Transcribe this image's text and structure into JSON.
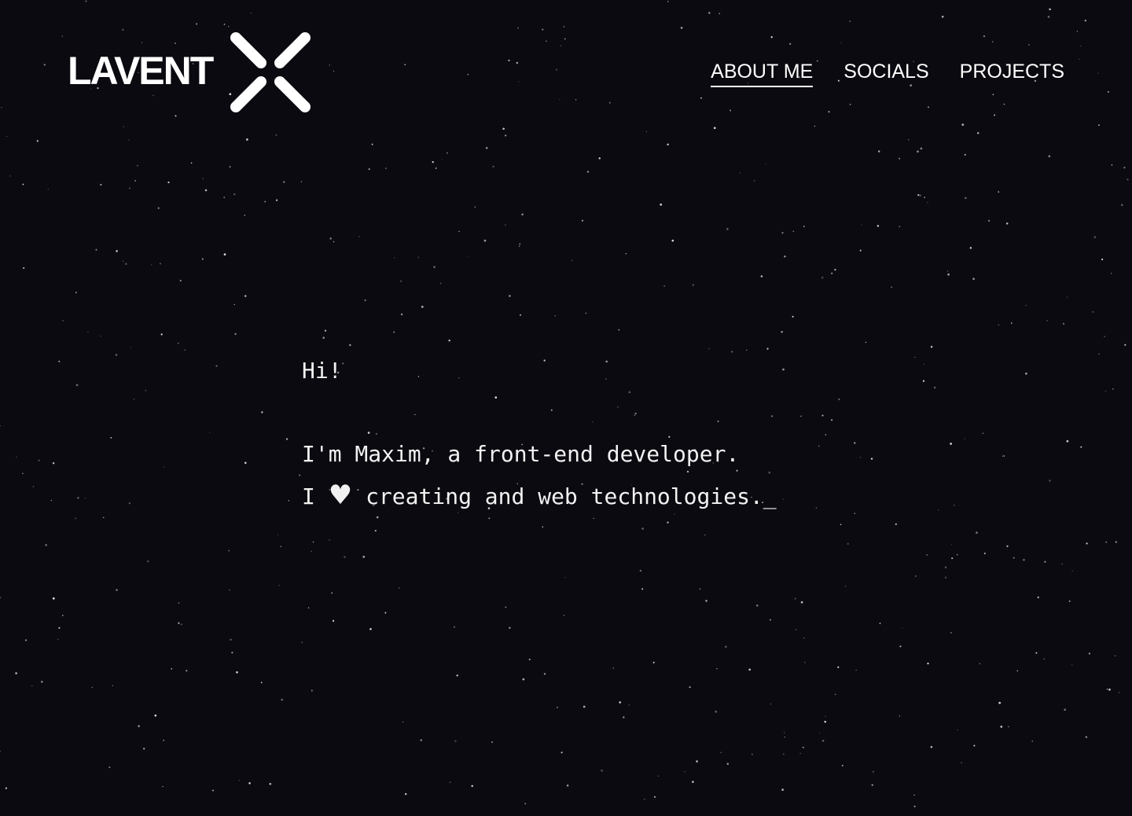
{
  "brand": {
    "name": "LAVENT",
    "mark_icon": "x-cross-icon"
  },
  "nav": {
    "items": [
      {
        "label": "ABOUT ME",
        "active": true
      },
      {
        "label": "SOCIALS",
        "active": false
      },
      {
        "label": "PROJECTS",
        "active": false
      }
    ]
  },
  "intro": {
    "greeting": "Hi!",
    "line1": "I'm Maxim, a front-end developer.",
    "line2_prefix": "I",
    "heart": "♥",
    "heart_icon": "heart-icon",
    "line2_suffix": "creating and web technologies.",
    "cursor": "_"
  },
  "colors": {
    "background": "#0a0a10",
    "text": "#ffffff"
  }
}
